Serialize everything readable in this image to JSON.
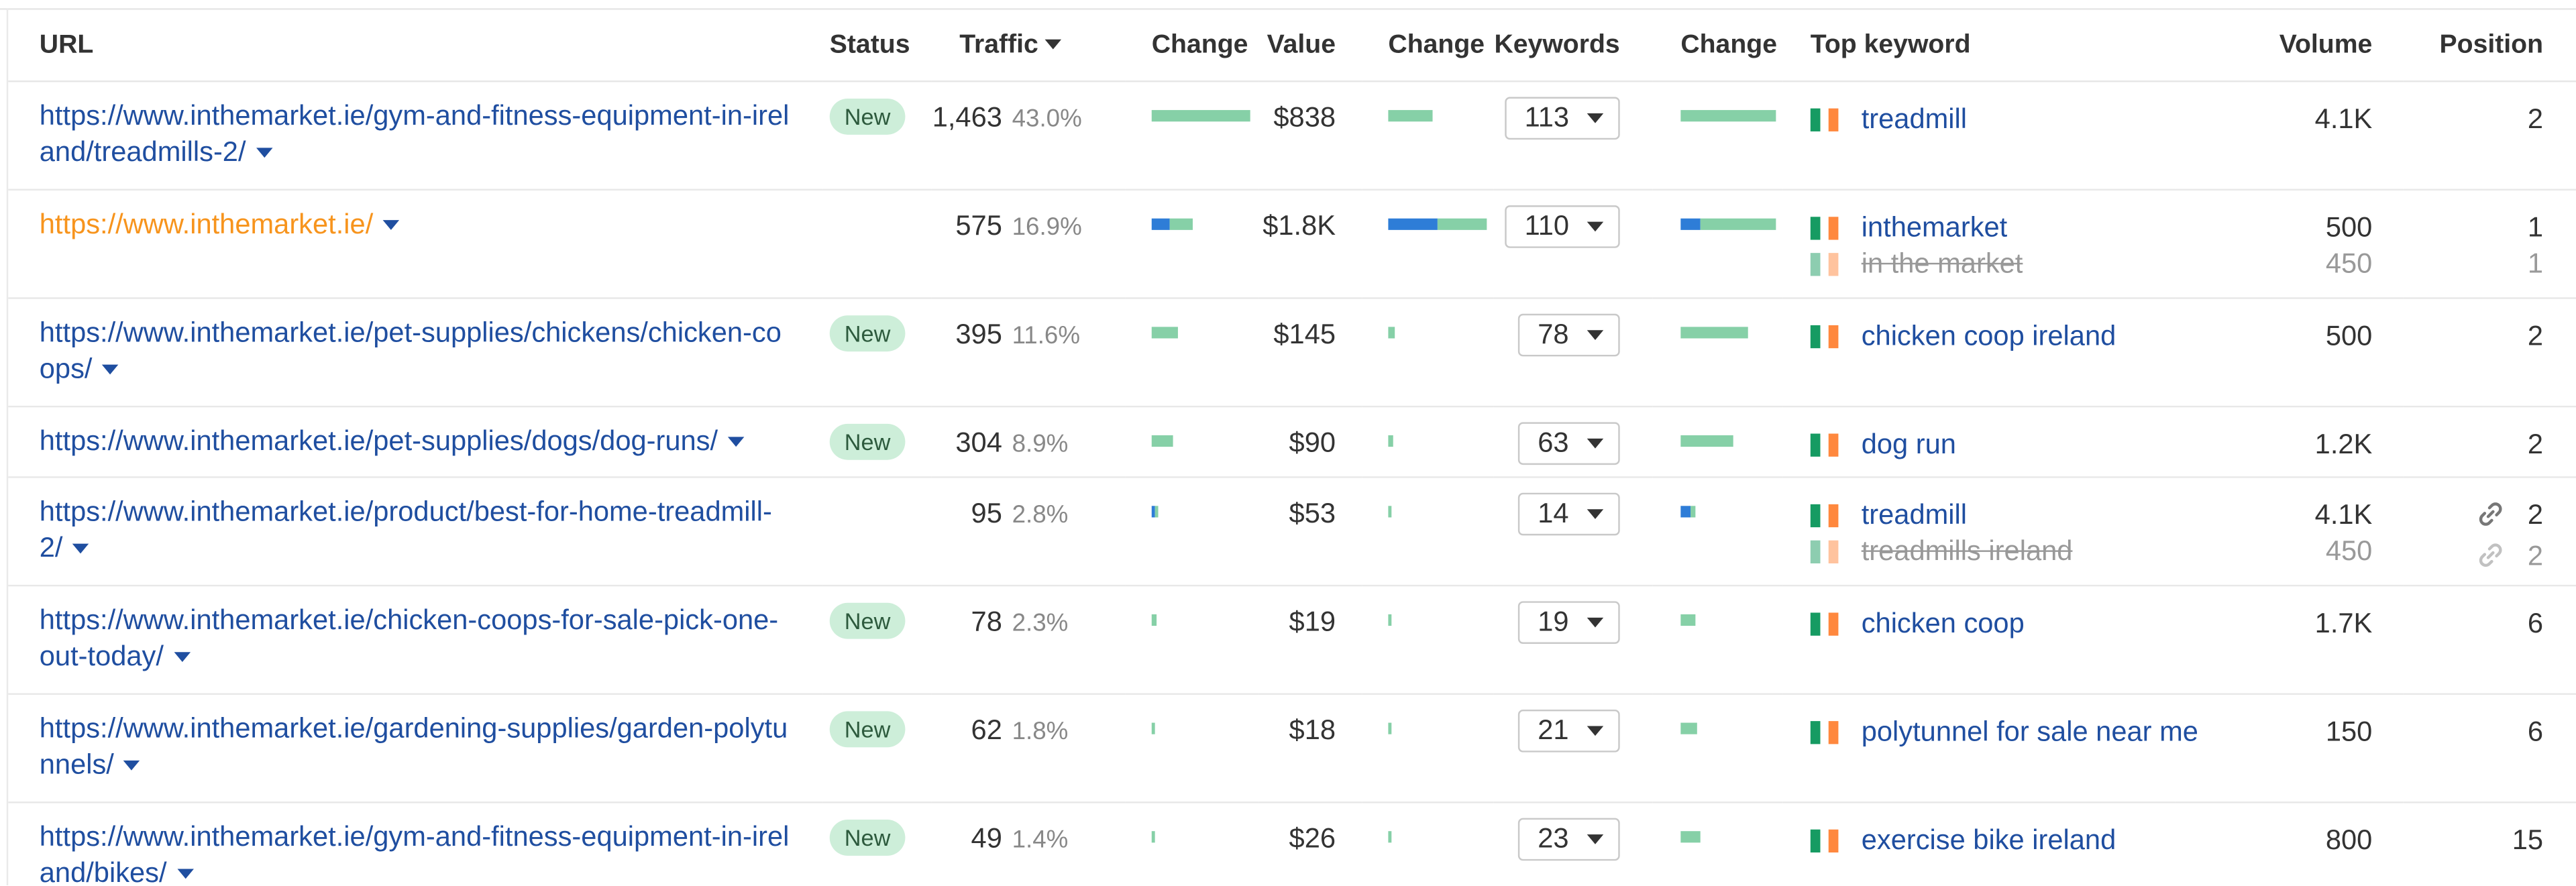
{
  "headers": {
    "url": "URL",
    "status": "Status",
    "traffic": "Traffic",
    "change": "Change",
    "value": "Value",
    "keywords": "Keywords",
    "top_keyword": "Top keyword",
    "volume": "Volume",
    "position": "Position"
  },
  "rows": [
    {
      "url_line1": "https://www.inthemarket.ie/gym-and-fitness-equipment-in-irel",
      "url_line2": "and/treadmills-2/",
      "status": "New",
      "traffic": "1,463",
      "traffic_pct": "43.0%",
      "value": "$838",
      "keywords": "113",
      "top_keywords": [
        {
          "keyword": "treadmill",
          "volume": "4.1K",
          "position": "2"
        }
      ]
    },
    {
      "url_line1": "https://www.inthemarket.ie/",
      "url_line2": "",
      "status": "",
      "traffic": "575",
      "traffic_pct": "16.9%",
      "value": "$1.8K",
      "keywords": "110",
      "top_keywords": [
        {
          "keyword": "inthemarket",
          "volume": "500",
          "position": "1"
        },
        {
          "keyword": "in the market",
          "volume": "450",
          "position": "1"
        }
      ]
    },
    {
      "url_line1": "https://www.inthemarket.ie/pet-supplies/chickens/chicken-co",
      "url_line2": "ops/",
      "status": "New",
      "traffic": "395",
      "traffic_pct": "11.6%",
      "value": "$145",
      "keywords": "78",
      "top_keywords": [
        {
          "keyword": "chicken coop ireland",
          "volume": "500",
          "position": "2"
        }
      ]
    },
    {
      "url_line1": "https://www.inthemarket.ie/pet-supplies/dogs/dog-runs/",
      "url_line2": "",
      "status": "New",
      "traffic": "304",
      "traffic_pct": "8.9%",
      "value": "$90",
      "keywords": "63",
      "top_keywords": [
        {
          "keyword": "dog run",
          "volume": "1.2K",
          "position": "2"
        }
      ]
    },
    {
      "url_line1": "https://www.inthemarket.ie/product/best-for-home-treadmill-",
      "url_line2": "2/",
      "status": "",
      "traffic": "95",
      "traffic_pct": "2.8%",
      "value": "$53",
      "keywords": "14",
      "top_keywords": [
        {
          "keyword": "treadmill",
          "volume": "4.1K",
          "position": "2"
        },
        {
          "keyword": "treadmills ireland",
          "volume": "450",
          "position": "2"
        }
      ]
    },
    {
      "url_line1": "https://www.inthemarket.ie/chicken-coops-for-sale-pick-one-",
      "url_line2": "out-today/",
      "status": "New",
      "traffic": "78",
      "traffic_pct": "2.3%",
      "value": "$19",
      "keywords": "19",
      "top_keywords": [
        {
          "keyword": "chicken coop",
          "volume": "1.7K",
          "position": "6"
        }
      ]
    },
    {
      "url_line1": "https://www.inthemarket.ie/gardening-supplies/garden-polytu",
      "url_line2": "nnels/",
      "status": "New",
      "traffic": "62",
      "traffic_pct": "1.8%",
      "value": "$18",
      "keywords": "21",
      "top_keywords": [
        {
          "keyword": "polytunnel for sale near me",
          "volume": "150",
          "position": "6"
        }
      ]
    },
    {
      "url_line1": "https://www.inthemarket.ie/gym-and-fitness-equipment-in-irel",
      "url_line2": "and/bikes/",
      "status": "New",
      "traffic": "49",
      "traffic_pct": "1.4%",
      "value": "$26",
      "keywords": "23",
      "top_keywords": [
        {
          "keyword": "exercise bike ireland",
          "volume": "800",
          "position": "15"
        }
      ]
    }
  ],
  "change_bars": {
    "traffic_change": [
      {
        "blue": 0,
        "green": 1.0
      },
      {
        "blue": 0.18,
        "green": 0.24
      },
      {
        "blue": 0,
        "green": 0.27
      },
      {
        "blue": 0,
        "green": 0.21
      },
      {
        "blue": 0.03,
        "green": 0.04
      },
      {
        "blue": 0,
        "green": 0.05
      },
      {
        "blue": 0,
        "green": 0.04
      },
      {
        "blue": 0,
        "green": 0.03
      }
    ],
    "value_change": [
      {
        "blue": 0,
        "green": 0.45
      },
      {
        "blue": 0.5,
        "green": 0.5
      },
      {
        "blue": 0,
        "green": 0.07
      },
      {
        "blue": 0,
        "green": 0.05
      },
      {
        "blue": 0,
        "green": 0.04
      },
      {
        "blue": 0,
        "green": 0.02
      },
      {
        "blue": 0,
        "green": 0.02
      },
      {
        "blue": 0,
        "green": 0.02
      }
    ],
    "keywords_change": [
      {
        "blue": 0,
        "green": 1.0
      },
      {
        "blue": 0.2,
        "green": 0.8
      },
      {
        "blue": 0,
        "green": 0.7
      },
      {
        "blue": 0,
        "green": 0.56
      },
      {
        "blue": 0.1,
        "green": 0.06
      },
      {
        "blue": 0,
        "green": 0.16
      },
      {
        "blue": 0,
        "green": 0.18
      },
      {
        "blue": 0,
        "green": 0.2
      }
    ]
  },
  "colors": {
    "link": "#1f4ea0",
    "home_link": "#f7941d",
    "bar_blue": "#2e7dd7",
    "bar_green": "#86d0a7",
    "new_badge": "#cdeed9",
    "flag": [
      "#169b62",
      "#ffffff",
      "#ff883e"
    ]
  },
  "icons": {
    "dropdown": "caret-down",
    "flag": "ireland-flag-icon",
    "serp_link": "link-icon"
  }
}
